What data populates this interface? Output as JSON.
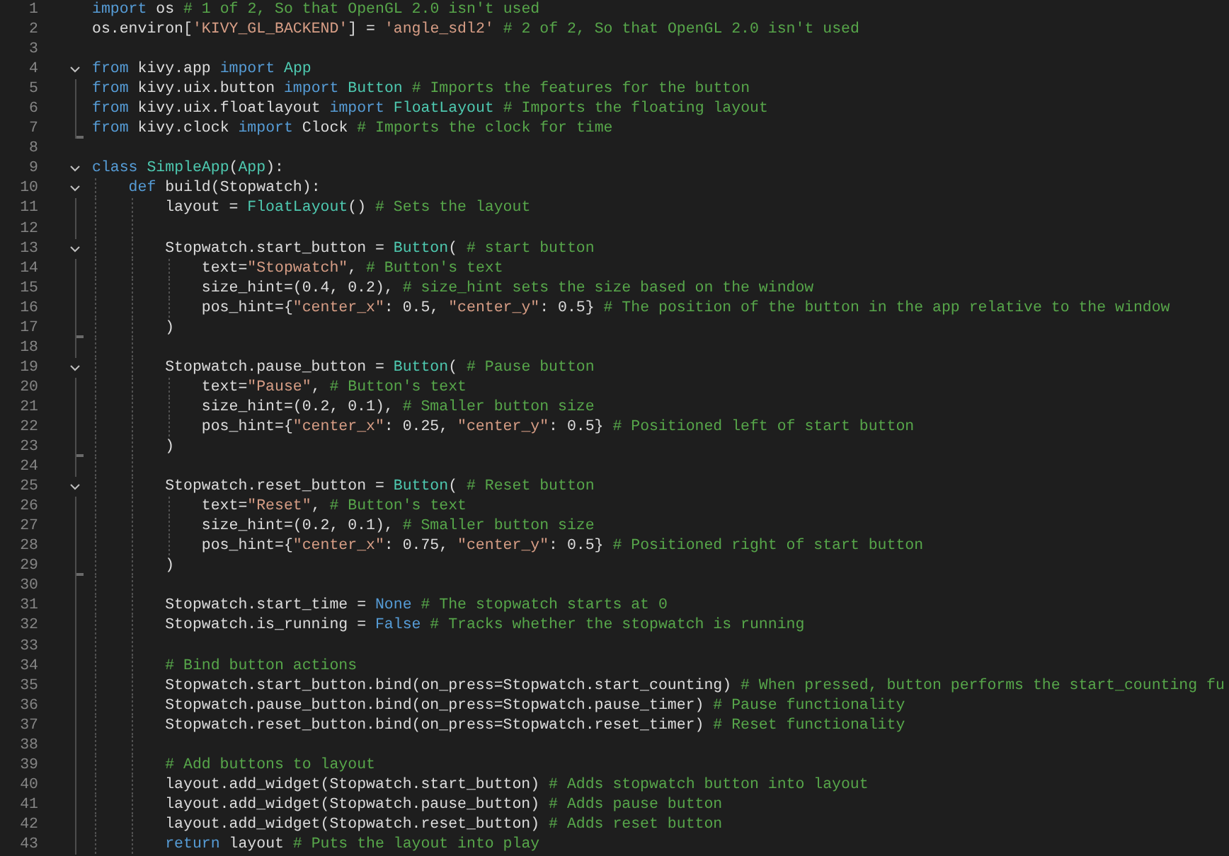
{
  "lines": [
    {
      "number": "1",
      "fold_start": false,
      "in_fold": false,
      "fold_end": false,
      "tokens": [
        {
          "kind": "keyword",
          "text": "import"
        },
        {
          "kind": "plain",
          "text": " os "
        },
        {
          "kind": "comment",
          "text": "# 1 of 2, So that OpenGL 2.0 isn't used"
        }
      ]
    },
    {
      "number": "2",
      "fold_start": false,
      "in_fold": false,
      "fold_end": false,
      "tokens": [
        {
          "kind": "plain",
          "text": "os.environ["
        },
        {
          "kind": "string",
          "text": "'KIVY_GL_BACKEND'"
        },
        {
          "kind": "plain",
          "text": "] = "
        },
        {
          "kind": "string",
          "text": "'angle_sdl2'"
        },
        {
          "kind": "comment",
          "text": " # 2 of 2, So that OpenGL 2.0 isn't used"
        }
      ]
    },
    {
      "number": "3",
      "fold_start": false,
      "in_fold": false,
      "fold_end": false
    },
    {
      "number": "4",
      "fold_start": true,
      "in_fold": false,
      "fold_end": false,
      "tokens": [
        {
          "kind": "keyword",
          "text": "from"
        },
        {
          "kind": "plain",
          "text": " kivy.app "
        },
        {
          "kind": "keyword",
          "text": "import"
        },
        {
          "kind": "class",
          "text": " App"
        }
      ]
    },
    {
      "number": "5",
      "fold_start": false,
      "in_fold": true,
      "fold_end": false,
      "tokens": [
        {
          "kind": "keyword",
          "text": "from"
        },
        {
          "kind": "plain",
          "text": " kivy.uix.button "
        },
        {
          "kind": "keyword",
          "text": "import"
        },
        {
          "kind": "class",
          "text": " Button"
        },
        {
          "kind": "comment",
          "text": " # Imports the features for the button"
        }
      ]
    },
    {
      "number": "6",
      "fold_start": false,
      "in_fold": true,
      "fold_end": false,
      "tokens": [
        {
          "kind": "keyword",
          "text": "from"
        },
        {
          "kind": "plain",
          "text": " kivy.uix.floatlayout "
        },
        {
          "kind": "keyword",
          "text": "import"
        },
        {
          "kind": "class",
          "text": " FloatLayout"
        },
        {
          "kind": "comment",
          "text": " # Imports the floating layout"
        }
      ]
    },
    {
      "number": "7",
      "fold_start": false,
      "in_fold": true,
      "fold_end": true,
      "tokens": [
        {
          "kind": "keyword",
          "text": "from"
        },
        {
          "kind": "plain",
          "text": " kivy.clock "
        },
        {
          "kind": "keyword",
          "text": "import"
        },
        {
          "kind": "plain",
          "text": " Clock"
        },
        {
          "kind": "comment",
          "text": " # Imports the clock for time"
        }
      ]
    },
    {
      "number": "8",
      "fold_start": false,
      "in_fold": false,
      "fold_end": false
    },
    {
      "number": "9",
      "fold_start": true,
      "in_fold": false,
      "fold_end": false,
      "tokens": [
        {
          "kind": "keyword",
          "text": "class"
        },
        {
          "kind": "class",
          "text": " SimpleApp"
        },
        {
          "kind": "plain",
          "text": "("
        },
        {
          "kind": "class",
          "text": "App"
        },
        {
          "kind": "plain",
          "text": "):"
        }
      ]
    },
    {
      "number": "10",
      "fold_start": true,
      "in_fold": true,
      "fold_end": false,
      "tokens": [
        {
          "kind": "keyword",
          "text": "    def"
        },
        {
          "kind": "plain",
          "text": " build(Stopwatch):"
        }
      ]
    },
    {
      "number": "11",
      "fold_start": false,
      "in_fold": true,
      "fold_end": false,
      "tokens": [
        {
          "kind": "plain",
          "text": "        layout = "
        },
        {
          "kind": "class",
          "text": "FloatLayout"
        },
        {
          "kind": "plain",
          "text": "() "
        },
        {
          "kind": "comment",
          "text": "# Sets the layout"
        }
      ]
    },
    {
      "number": "12",
      "fold_start": false,
      "in_fold": true,
      "fold_end": false
    },
    {
      "number": "13",
      "fold_start": true,
      "in_fold": true,
      "fold_end": false,
      "tokens": [
        {
          "kind": "plain",
          "text": "        Stopwatch.start_button = "
        },
        {
          "kind": "class",
          "text": "Button"
        },
        {
          "kind": "plain",
          "text": "( "
        },
        {
          "kind": "comment",
          "text": "# start button"
        }
      ]
    },
    {
      "number": "14",
      "fold_start": false,
      "in_fold": true,
      "fold_end": false,
      "tokens": [
        {
          "kind": "plain",
          "text": "            text="
        },
        {
          "kind": "string",
          "text": "\"Stopwatch\""
        },
        {
          "kind": "plain",
          "text": ", "
        },
        {
          "kind": "comment",
          "text": "# Button's text"
        }
      ]
    },
    {
      "number": "15",
      "fold_start": false,
      "in_fold": true,
      "fold_end": false,
      "tokens": [
        {
          "kind": "plain",
          "text": "            size_hint=(0.4, 0.2), "
        },
        {
          "kind": "comment",
          "text": "# size_hint sets the size based on the window"
        }
      ]
    },
    {
      "number": "16",
      "fold_start": false,
      "in_fold": true,
      "fold_end": false,
      "tokens": [
        {
          "kind": "plain",
          "text": "            pos_hint={"
        },
        {
          "kind": "string",
          "text": "\"center_x\""
        },
        {
          "kind": "plain",
          "text": ": 0.5, "
        },
        {
          "kind": "string",
          "text": "\"center_y\""
        },
        {
          "kind": "plain",
          "text": ": 0.5} "
        },
        {
          "kind": "comment",
          "text": "# The position of the button in the app relative to the window"
        }
      ]
    },
    {
      "number": "17",
      "fold_start": false,
      "in_fold": true,
      "fold_end": true,
      "tokens": [
        {
          "kind": "plain",
          "text": "        )"
        }
      ]
    },
    {
      "number": "18",
      "fold_start": false,
      "in_fold": true,
      "fold_end": false
    },
    {
      "number": "19",
      "fold_start": true,
      "in_fold": true,
      "fold_end": false,
      "tokens": [
        {
          "kind": "plain",
          "text": "        Stopwatch.pause_button = "
        },
        {
          "kind": "class",
          "text": "Button"
        },
        {
          "kind": "plain",
          "text": "( "
        },
        {
          "kind": "comment",
          "text": "# Pause button"
        }
      ]
    },
    {
      "number": "20",
      "fold_start": false,
      "in_fold": true,
      "fold_end": false,
      "tokens": [
        {
          "kind": "plain",
          "text": "            text="
        },
        {
          "kind": "string",
          "text": "\"Pause\""
        },
        {
          "kind": "plain",
          "text": ", "
        },
        {
          "kind": "comment",
          "text": "# Button's text"
        }
      ]
    },
    {
      "number": "21",
      "fold_start": false,
      "in_fold": true,
      "fold_end": false,
      "tokens": [
        {
          "kind": "plain",
          "text": "            size_hint=(0.2, 0.1), "
        },
        {
          "kind": "comment",
          "text": "# Smaller button size"
        }
      ]
    },
    {
      "number": "22",
      "fold_start": false,
      "in_fold": true,
      "fold_end": false,
      "tokens": [
        {
          "kind": "plain",
          "text": "            pos_hint={"
        },
        {
          "kind": "string",
          "text": "\"center_x\""
        },
        {
          "kind": "plain",
          "text": ": 0.25, "
        },
        {
          "kind": "string",
          "text": "\"center_y\""
        },
        {
          "kind": "plain",
          "text": ": 0.5} "
        },
        {
          "kind": "comment",
          "text": "# Positioned left of start button"
        }
      ]
    },
    {
      "number": "23",
      "fold_start": false,
      "in_fold": true,
      "fold_end": true,
      "tokens": [
        {
          "kind": "plain",
          "text": "        )"
        }
      ]
    },
    {
      "number": "24",
      "fold_start": false,
      "in_fold": true,
      "fold_end": false
    },
    {
      "number": "25",
      "fold_start": true,
      "in_fold": true,
      "fold_end": false,
      "tokens": [
        {
          "kind": "plain",
          "text": "        Stopwatch.reset_button = "
        },
        {
          "kind": "class",
          "text": "Button"
        },
        {
          "kind": "plain",
          "text": "( "
        },
        {
          "kind": "comment",
          "text": "# Reset button"
        }
      ]
    },
    {
      "number": "26",
      "fold_start": false,
      "in_fold": true,
      "fold_end": false,
      "tokens": [
        {
          "kind": "plain",
          "text": "            text="
        },
        {
          "kind": "string",
          "text": "\"Reset\""
        },
        {
          "kind": "plain",
          "text": ", "
        },
        {
          "kind": "comment",
          "text": "# Button's text"
        }
      ]
    },
    {
      "number": "27",
      "fold_start": false,
      "in_fold": true,
      "fold_end": false,
      "tokens": [
        {
          "kind": "plain",
          "text": "            size_hint=(0.2, 0.1), "
        },
        {
          "kind": "comment",
          "text": "# Smaller button size"
        }
      ]
    },
    {
      "number": "28",
      "fold_start": false,
      "in_fold": true,
      "fold_end": false,
      "tokens": [
        {
          "kind": "plain",
          "text": "            pos_hint={"
        },
        {
          "kind": "string",
          "text": "\"center_x\""
        },
        {
          "kind": "plain",
          "text": ": 0.75, "
        },
        {
          "kind": "string",
          "text": "\"center_y\""
        },
        {
          "kind": "plain",
          "text": ": 0.5} "
        },
        {
          "kind": "comment",
          "text": "# Positioned right of start button"
        }
      ]
    },
    {
      "number": "29",
      "fold_start": false,
      "in_fold": true,
      "fold_end": true,
      "tokens": [
        {
          "kind": "plain",
          "text": "        )"
        }
      ]
    },
    {
      "number": "30",
      "fold_start": false,
      "in_fold": true,
      "fold_end": false
    },
    {
      "number": "31",
      "fold_start": false,
      "in_fold": true,
      "fold_end": false,
      "tokens": [
        {
          "kind": "plain",
          "text": "        Stopwatch.start_time = "
        },
        {
          "kind": "keyword",
          "text": "None"
        },
        {
          "kind": "comment",
          "text": " # The stopwatch starts at 0"
        }
      ]
    },
    {
      "number": "32",
      "fold_start": false,
      "in_fold": true,
      "fold_end": false,
      "tokens": [
        {
          "kind": "plain",
          "text": "        Stopwatch.is_running = "
        },
        {
          "kind": "keyword",
          "text": "False"
        },
        {
          "kind": "comment",
          "text": " # Tracks whether the stopwatch is running"
        }
      ]
    },
    {
      "number": "33",
      "fold_start": false,
      "in_fold": true,
      "fold_end": false
    },
    {
      "number": "34",
      "fold_start": false,
      "in_fold": true,
      "fold_end": false,
      "tokens": [
        {
          "kind": "comment",
          "text": "        # Bind button actions"
        }
      ]
    },
    {
      "number": "35",
      "fold_start": false,
      "in_fold": true,
      "fold_end": false,
      "tokens": [
        {
          "kind": "plain",
          "text": "        Stopwatch.start_button.bind(on_press=Stopwatch.start_counting) "
        },
        {
          "kind": "comment",
          "text": "# When pressed, button performs the start_counting fu"
        }
      ]
    },
    {
      "number": "36",
      "fold_start": false,
      "in_fold": true,
      "fold_end": false,
      "tokens": [
        {
          "kind": "plain",
          "text": "        Stopwatch.pause_button.bind(on_press=Stopwatch.pause_timer) "
        },
        {
          "kind": "comment",
          "text": "# Pause functionality"
        }
      ]
    },
    {
      "number": "37",
      "fold_start": false,
      "in_fold": true,
      "fold_end": false,
      "tokens": [
        {
          "kind": "plain",
          "text": "        Stopwatch.reset_button.bind(on_press=Stopwatch.reset_timer) "
        },
        {
          "kind": "comment",
          "text": "# Reset functionality"
        }
      ]
    },
    {
      "number": "38",
      "fold_start": false,
      "in_fold": true,
      "fold_end": false
    },
    {
      "number": "39",
      "fold_start": false,
      "in_fold": true,
      "fold_end": false,
      "tokens": [
        {
          "kind": "comment",
          "text": "        # Add buttons to layout"
        }
      ]
    },
    {
      "number": "40",
      "fold_start": false,
      "in_fold": true,
      "fold_end": false,
      "tokens": [
        {
          "kind": "plain",
          "text": "        layout.add_widget(Stopwatch.start_button) "
        },
        {
          "kind": "comment",
          "text": "# Adds stopwatch button into layout"
        }
      ]
    },
    {
      "number": "41",
      "fold_start": false,
      "in_fold": true,
      "fold_end": false,
      "tokens": [
        {
          "kind": "plain",
          "text": "        layout.add_widget(Stopwatch.pause_button) "
        },
        {
          "kind": "comment",
          "text": "# Adds pause button"
        }
      ]
    },
    {
      "number": "42",
      "fold_start": false,
      "in_fold": true,
      "fold_end": false,
      "tokens": [
        {
          "kind": "plain",
          "text": "        layout.add_widget(Stopwatch.reset_button) "
        },
        {
          "kind": "comment",
          "text": "# Adds reset button"
        }
      ]
    },
    {
      "number": "43",
      "fold_start": false,
      "in_fold": true,
      "fold_end": false,
      "tokens": [
        {
          "kind": "keyword",
          "text": "        return"
        },
        {
          "kind": "plain",
          "text": " layout "
        },
        {
          "kind": "comment",
          "text": "# Puts the layout into play"
        }
      ]
    }
  ]
}
